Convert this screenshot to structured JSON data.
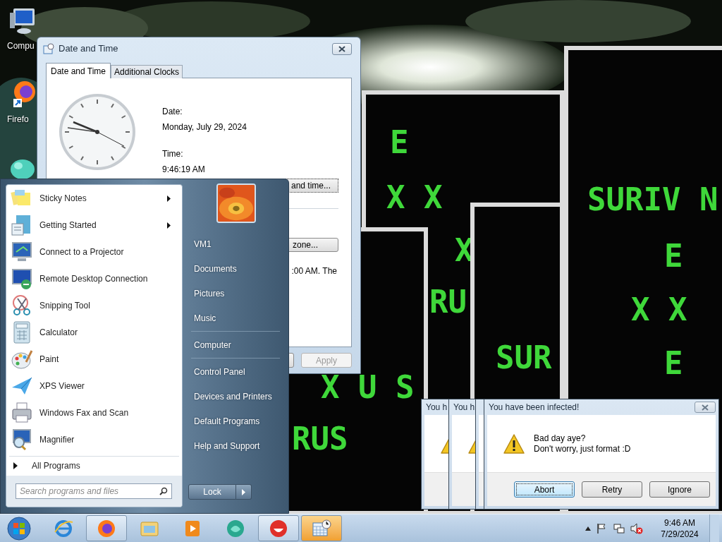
{
  "desktop_icons": [
    {
      "label": "Compu"
    },
    {
      "label": "Firefo"
    }
  ],
  "virus_windows": [
    {
      "glyphs": [
        "E",
        "X X",
        "X",
        "RU"
      ]
    },
    {
      "glyphs": [
        "SURIV N",
        "E",
        "X X",
        "E"
      ]
    },
    {
      "glyphs": [
        "X U S",
        "RUS"
      ]
    },
    {
      "glyphs": [
        "SUR"
      ]
    }
  ],
  "date_time_window": {
    "title": "Date and Time",
    "tabs": [
      {
        "label": "Date and Time",
        "selected": true
      },
      {
        "label": "Additional Clocks",
        "selected": false
      }
    ],
    "date_label": "Date:",
    "date": "Monday, July 29, 2024",
    "time_label": "Time:",
    "time": "9:46:19 AM",
    "change_button": "and time...",
    "zone_button": "zone...",
    "note": ":00 AM. The",
    "apply_button": {
      "label": "Apply",
      "disabled": true
    }
  },
  "start_menu": {
    "programs": [
      {
        "label": "Sticky Notes",
        "submenu": true
      },
      {
        "label": "Getting Started",
        "submenu": true
      },
      {
        "label": "Connect to a Projector",
        "submenu": false
      },
      {
        "label": "Remote Desktop Connection",
        "submenu": false
      },
      {
        "label": "Snipping Tool",
        "submenu": false
      },
      {
        "label": "Calculator",
        "submenu": false
      },
      {
        "label": "Paint",
        "submenu": false
      },
      {
        "label": "XPS Viewer",
        "submenu": false
      },
      {
        "label": "Windows Fax and Scan",
        "submenu": false
      },
      {
        "label": "Magnifier",
        "submenu": false
      }
    ],
    "all_programs": "All Programs",
    "search": {
      "placeholder": "Search programs and files"
    },
    "place_groups": [
      {
        "items": [
          "VM1",
          "Documents",
          "Pictures",
          "Music"
        ]
      },
      {
        "items": [
          "Computer"
        ]
      },
      {
        "items": [
          "Control Panel",
          "Devices and Printers",
          "Default Programs",
          "Help and Support"
        ]
      }
    ],
    "lock_button": "Lock"
  },
  "dialogs": [
    {
      "kind": "back",
      "title": "You h"
    },
    {
      "kind": "back",
      "title": "You h"
    },
    {
      "kind": "back"
    },
    {
      "kind": "main",
      "title": "You have been infected!",
      "message": [
        "Bad day aye?",
        "Don't worry, just format :D"
      ],
      "buttons": [
        {
          "label": "Abort",
          "selected": true
        },
        {
          "label": "Retry",
          "selected": false
        },
        {
          "label": "Ignore",
          "selected": false
        }
      ]
    }
  ],
  "taskbar": {
    "items": [
      {
        "open": false,
        "selected": false
      },
      {
        "open": true,
        "selected": false
      },
      {
        "open": false,
        "selected": false
      },
      {
        "open": false,
        "selected": false
      },
      {
        "open": false,
        "selected": false
      },
      {
        "open": true,
        "selected": false
      },
      {
        "open": true,
        "selected": true
      }
    ],
    "time": "9:46 AM",
    "date": "7/29/2024"
  }
}
